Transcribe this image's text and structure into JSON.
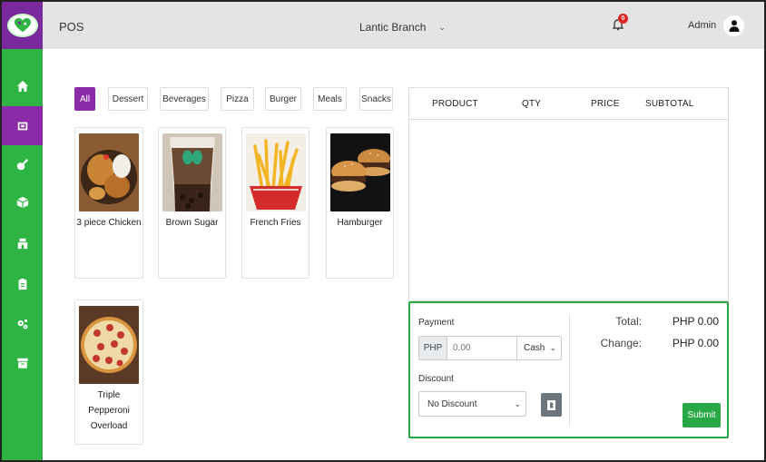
{
  "header": {
    "title": "POS",
    "branch": "Lantic Branch",
    "notifications_count": "0",
    "user": "Admin"
  },
  "sidebar": {
    "items": [
      {
        "icon": "home-icon",
        "active": false
      },
      {
        "icon": "pos-register-icon",
        "active": true
      },
      {
        "icon": "guitar-icon",
        "active": false
      },
      {
        "icon": "box-icon",
        "active": false
      },
      {
        "icon": "store-icon",
        "active": false
      },
      {
        "icon": "clipboard-icon",
        "active": false
      },
      {
        "icon": "cogs-icon",
        "active": false
      },
      {
        "icon": "archive-icon",
        "active": false
      }
    ]
  },
  "categories": [
    {
      "label": "All",
      "active": true
    },
    {
      "label": "Dessert",
      "active": false
    },
    {
      "label": "Beverages",
      "active": false
    },
    {
      "label": "Pizza",
      "active": false
    },
    {
      "label": "Burger",
      "active": false
    },
    {
      "label": "Meals",
      "active": false
    },
    {
      "label": "Snacks",
      "active": false
    }
  ],
  "products": [
    {
      "name": "3 piece Chicken",
      "image": "chicken-photo"
    },
    {
      "name": "Brown Sugar",
      "image": "milk-tea-photo"
    },
    {
      "name": "French Fries",
      "image": "fries-photo"
    },
    {
      "name": "Hamburger",
      "image": "burger-photo"
    },
    {
      "name_lines": [
        "Triple",
        "Pepperoni",
        "Overload"
      ],
      "image": "pizza-photo"
    }
  ],
  "order_table": {
    "columns": [
      "PRODUCT",
      "QTY",
      "PRICE",
      "SUBTOTAL"
    ],
    "rows": []
  },
  "payment": {
    "label": "Payment",
    "currency_prefix": "PHP",
    "amount_placeholder": "0.00",
    "method": "Cash",
    "discount_label": "Discount",
    "discount_value": "No Discount",
    "total_label": "Total:",
    "total_value": "PHP 0.00",
    "change_label": "Change:",
    "change_value": "PHP 0.00",
    "submit_label": "Submit"
  },
  "colors": {
    "sidebar": "#2db443",
    "accent_purple": "#8a2aa8",
    "success_green": "#28a745",
    "topbar": "#e4e4e4"
  }
}
